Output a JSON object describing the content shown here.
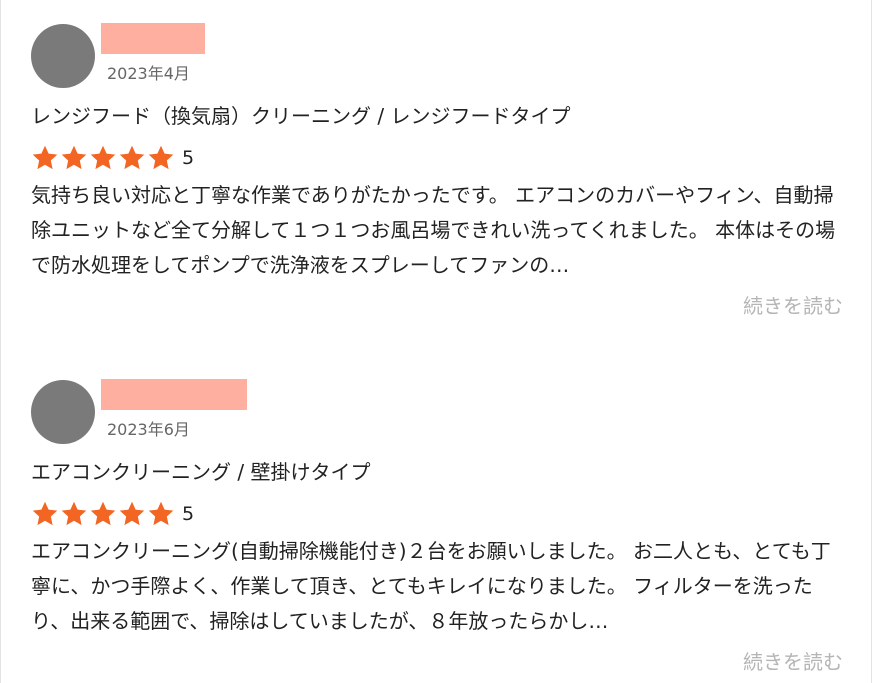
{
  "colors": {
    "star": "#f26522",
    "avatar": "#7a7a7a",
    "name_mask": "#ffaf9f",
    "read_more": "#b5b5b5"
  },
  "reviews": [
    {
      "date": "2023年4月",
      "service": "レンジフード（換気扇）クリーニング / レンジフードタイプ",
      "stars": 5,
      "rating_label": "5",
      "body": "気持ち良い対応と丁寧な作業でありがたかったです。 エアコンのカバーやフィン、自動掃除ユニットなど全て分解して１つ１つお風呂場できれい洗ってくれました。 本体はその場で防水処理をしてポンプで洗浄液をスプレーしてファンの…",
      "read_more": "続きを読む"
    },
    {
      "date": "2023年6月",
      "service": "エアコンクリーニング / 壁掛けタイプ",
      "stars": 5,
      "rating_label": "5",
      "body": "エアコンクリーニング(自動掃除機能付き)２台をお願いしました。 お二人とも、とても丁寧に、かつ手際よく、作業して頂き、とてもキレイになりました。 フィルターを洗ったり、出来る範囲で、掃除はしていましたが、８年放ったらかし…",
      "read_more": "続きを読む"
    }
  ]
}
